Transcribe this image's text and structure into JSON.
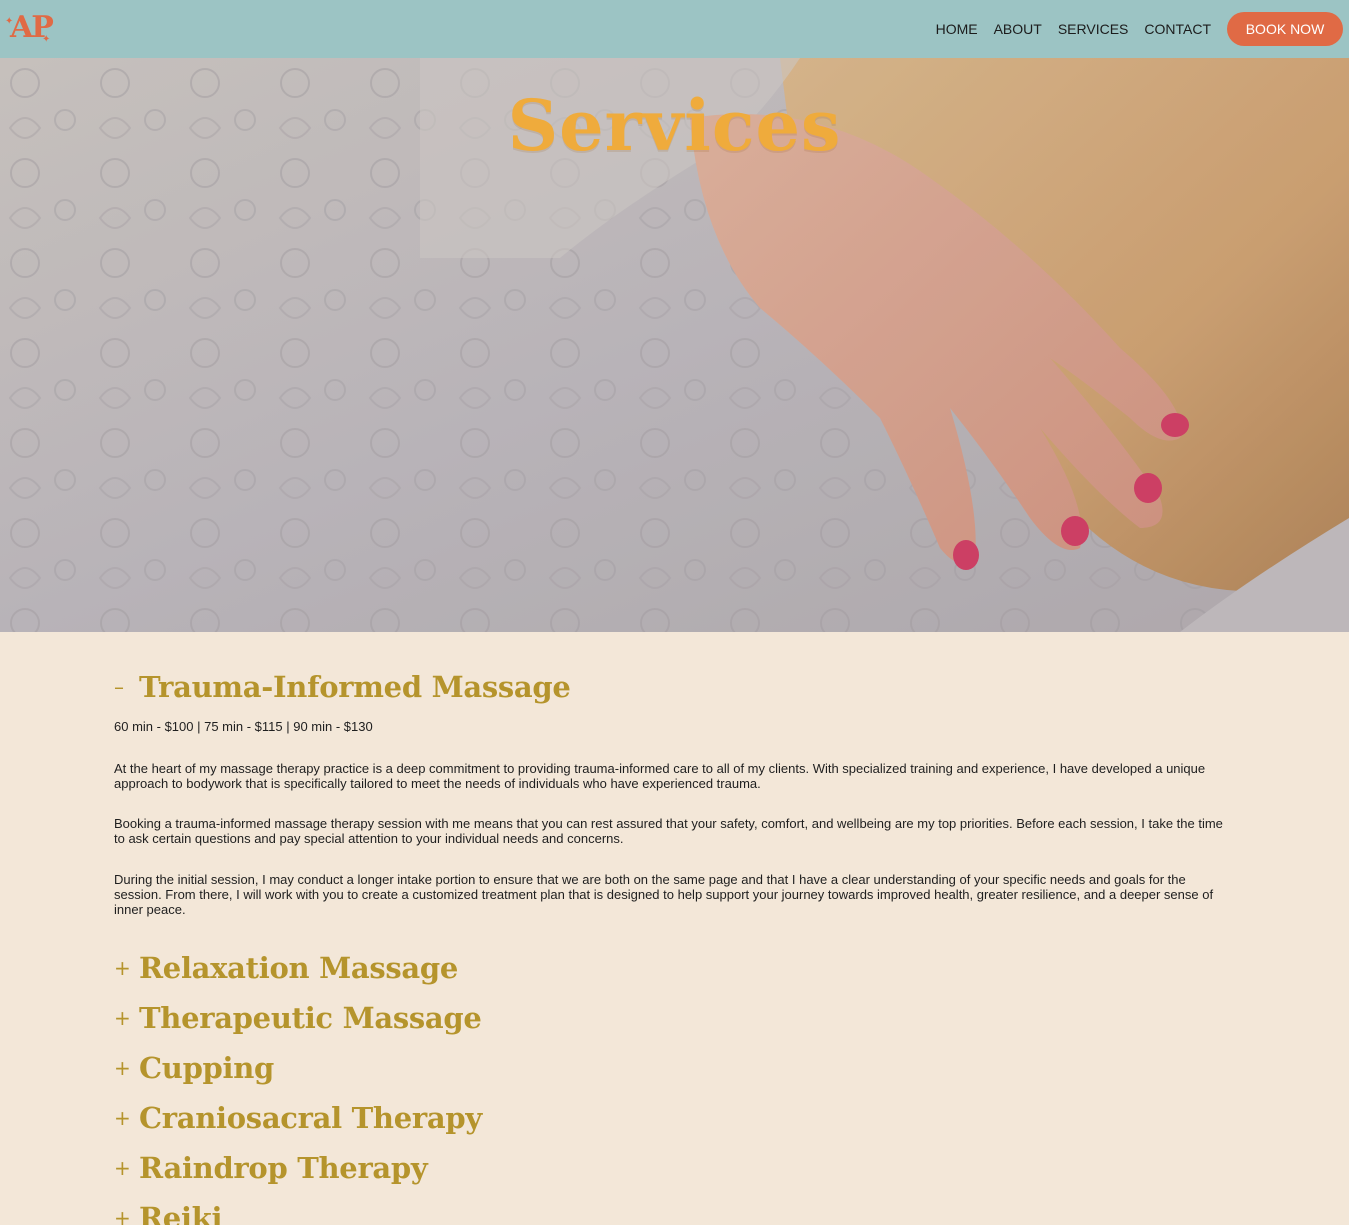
{
  "header": {
    "logo_text": "AP",
    "nav": [
      "HOME",
      "ABOUT",
      "SERVICES",
      "CONTACT"
    ],
    "book_label": "BOOK NOW",
    "colors": {
      "bar": "#9cc4c4",
      "accent": "#e06a45"
    }
  },
  "hero": {
    "title": "Services",
    "title_color": "#efab3c"
  },
  "services": {
    "expanded": {
      "sign": "–",
      "title": "Trauma-Informed Massage",
      "price": "60 min - $100 | 75 min - $115 | 90 min - $130",
      "paragraphs": [
        "At the heart of my massage therapy practice is a deep commitment to providing trauma-informed care to all of my clients. With specialized training and experience, I have developed a unique approach to bodywork that is specifically tailored to meet the needs of individuals who have experienced trauma.",
        "Booking a trauma-informed massage therapy session with me means that you can rest assured that your safety, comfort, and wellbeing are my top priorities. Before each session, I take the time to ask certain questions and pay special attention to your individual needs and concerns.",
        "During the initial session, I may conduct a longer intake portion to ensure that we are both on the same page and that I have a clear understanding of your specific needs and goals for the session. From there, I will work with you to create a customized treatment plan that is designed to help support your journey towards improved health, greater resilience, and a deeper sense of inner peace."
      ]
    },
    "collapsed_sign": "+",
    "collapsed": [
      "Relaxation Massage",
      "Therapeutic Massage",
      "Cupping",
      "Craniosacral Therapy",
      "Raindrop Therapy",
      "Reiki"
    ]
  }
}
